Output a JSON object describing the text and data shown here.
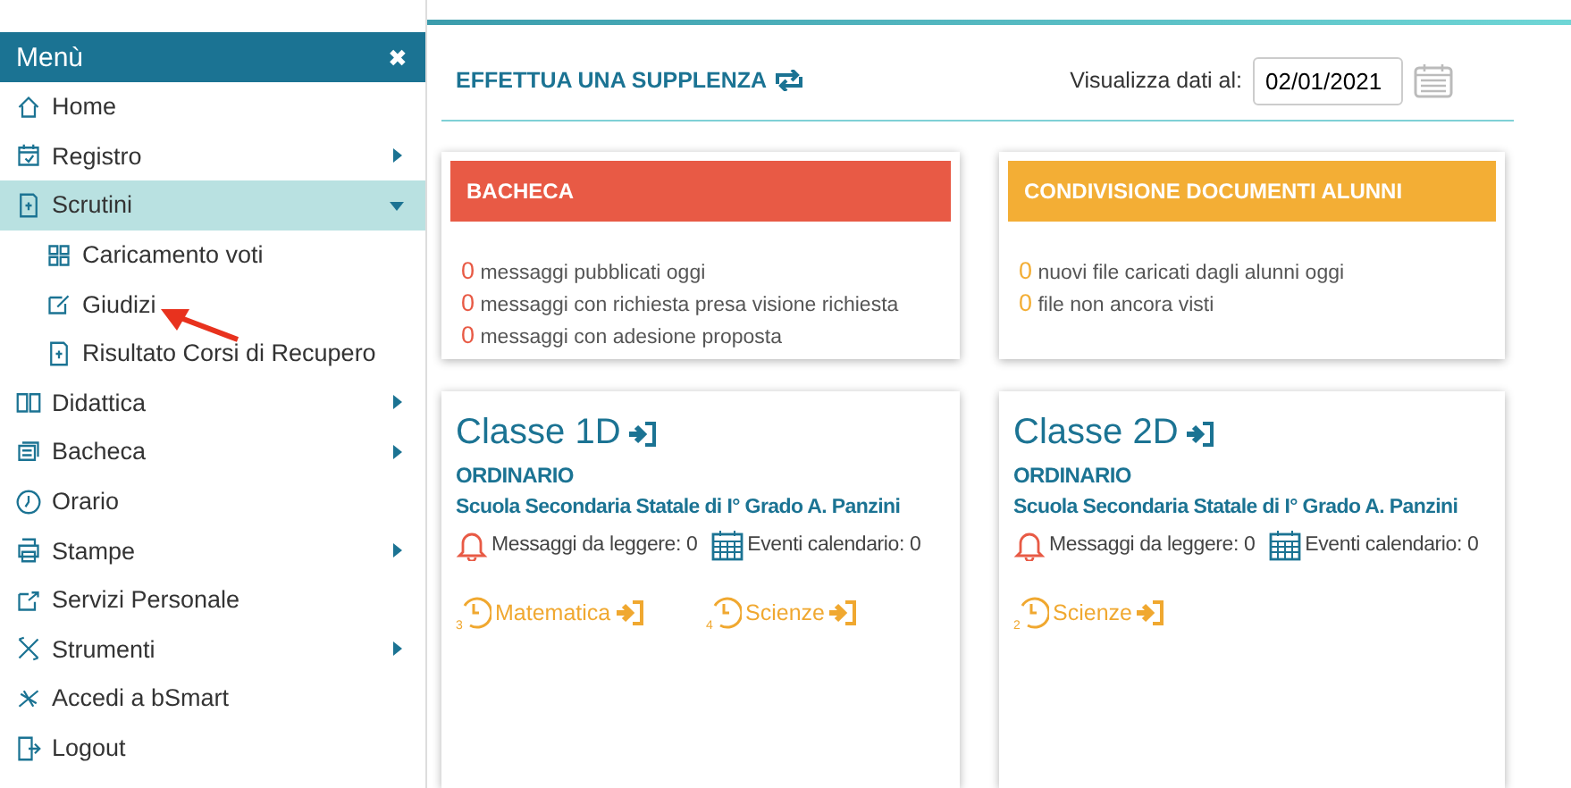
{
  "menu": {
    "title": "Menù",
    "close": "✖",
    "items": [
      {
        "label": "Home"
      },
      {
        "label": "Registro",
        "expanded": false
      },
      {
        "label": "Scrutini",
        "expanded": true,
        "selected": true,
        "children": [
          {
            "label": "Caricamento voti"
          },
          {
            "label": "Giudizi"
          },
          {
            "label": "Risultato Corsi di Recupero"
          }
        ]
      },
      {
        "label": "Didattica",
        "expanded": false
      },
      {
        "label": "Bacheca",
        "expanded": false
      },
      {
        "label": "Orario"
      },
      {
        "label": "Stampe",
        "expanded": false
      },
      {
        "label": "Servizi Personale"
      },
      {
        "label": "Strumenti",
        "expanded": false
      },
      {
        "label": "Accedi a bSmart"
      },
      {
        "label": "Logout"
      }
    ]
  },
  "toolbar": {
    "substitution_link": "EFFETTUA UNA SUPPLENZA",
    "date_label": "Visualizza dati al:",
    "date_value": "02/01/2021"
  },
  "summary_cards": [
    {
      "title": "BACHECA",
      "color": "#e85a45",
      "lines": [
        {
          "count": "0",
          "text": "messaggi pubblicati oggi"
        },
        {
          "count": "0",
          "text": "messaggi con richiesta presa visione richiesta"
        },
        {
          "count": "0",
          "text": "messaggi con adesione proposta"
        }
      ]
    },
    {
      "title": "CONDIVISIONE DOCUMENTI ALUNNI",
      "color": "#f3ae35",
      "lines": [
        {
          "count": "0",
          "text": "nuovi file caricati dagli alunni oggi"
        },
        {
          "count": "0",
          "text": "file non ancora visti"
        }
      ]
    }
  ],
  "classes": [
    {
      "title": "Classe 1D",
      "type": "ORDINARIO",
      "school": "Scuola Secondaria Statale di I° Grado A. Panzini",
      "messages": "Messaggi da leggere: 0",
      "events": "Eventi calendario: 0",
      "lessons": [
        {
          "hour": "3",
          "subject": "Matematica"
        },
        {
          "hour": "4",
          "subject": "Scienze"
        }
      ]
    },
    {
      "title": "Classe 2D",
      "type": "ORDINARIO",
      "school": "Scuola Secondaria Statale di I° Grado A. Panzini",
      "messages": "Messaggi da leggere: 0",
      "events": "Eventi calendario: 0",
      "lessons": [
        {
          "hour": "2",
          "subject": "Scienze"
        }
      ]
    }
  ]
}
